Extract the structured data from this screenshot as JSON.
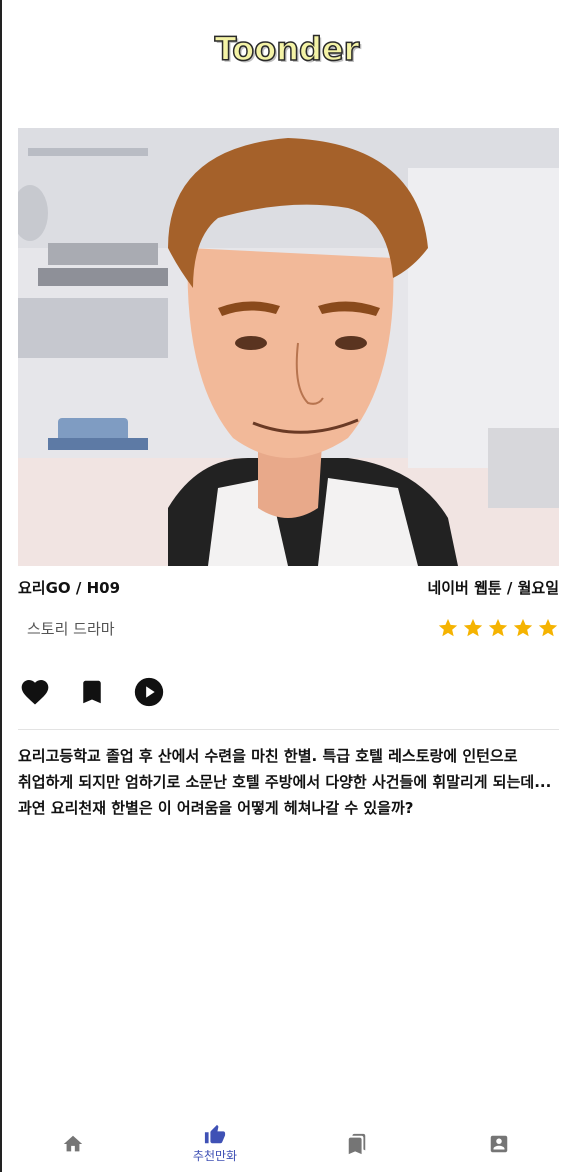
{
  "app": {
    "title": "Toonder"
  },
  "webtoon": {
    "title_author": "요리GO / H09",
    "platform_day": "네이버 웹툰 / 월요일",
    "genre": "스토리 드라마",
    "rating": 5,
    "rating_max": 5,
    "description": "요리고등학교 졸업 후 산에서 수련을 마친 한별. 특급 호텔 레스토랑에 인턴으로 취업하게 되지만 엄하기로 소문난 호텔 주방에서 다양한 사건들에 휘말리게 되는데... 과연 요리천재 한별은 이 어려움을 어떻게 헤쳐나갈 수 있을까?"
  },
  "actions": [
    {
      "icon": "heart-icon"
    },
    {
      "icon": "bookmark-icon"
    },
    {
      "icon": "play-circle-icon"
    }
  ],
  "bottom_nav": {
    "items": [
      {
        "icon": "home-icon",
        "label": "",
        "active": false
      },
      {
        "icon": "thumb-up-icon",
        "label": "추천만화",
        "active": true
      },
      {
        "icon": "library-bookmarks-icon",
        "label": "",
        "active": false
      },
      {
        "icon": "profile-icon",
        "label": "",
        "active": false
      }
    ]
  },
  "colors": {
    "star": "#f5b301",
    "accent": "#3f51b5",
    "inactive_icon": "#757575"
  }
}
